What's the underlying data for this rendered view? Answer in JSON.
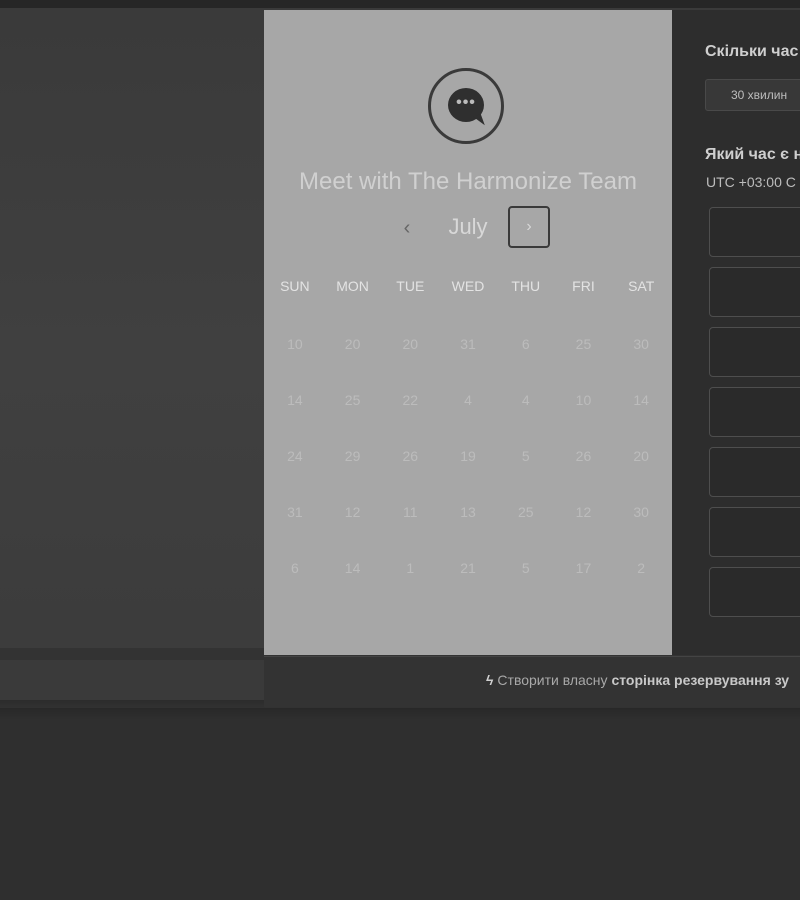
{
  "header": {
    "title": "Meet with The Harmonize Team",
    "avatar_icon": "chat-bubble-icon"
  },
  "calendar": {
    "month": "July",
    "prev_label": "‹",
    "next_label": "›",
    "weekdays": [
      "SUN",
      "MON",
      "TUE",
      "WED",
      "THU",
      "FRI",
      "SAT"
    ],
    "weeks": [
      [
        "10",
        "20",
        "20",
        "31",
        "6",
        "25",
        "30"
      ],
      [
        "14",
        "25",
        "22",
        "4",
        "4",
        "10",
        "14"
      ],
      [
        "24",
        "29",
        "26",
        "19",
        "5",
        "26",
        "20"
      ],
      [
        "31",
        "12",
        "11",
        "13",
        "25",
        "12",
        "30"
      ],
      [
        "6",
        "14",
        "1",
        "21",
        "5",
        "17",
        "2"
      ]
    ]
  },
  "booking": {
    "duration_question": "Скільки час",
    "duration_option": "30 хвилин",
    "time_question": "Який час є н",
    "timezone": "UTC +03:00 С"
  },
  "footer": {
    "prefix": "Створити власну",
    "link": "сторінка резервування зу",
    "icon": "sprocket-icon"
  },
  "colors": {
    "left_pane": "#a7a7a7",
    "right_pane": "#2d2d2d",
    "background": "#3c3c3c"
  }
}
